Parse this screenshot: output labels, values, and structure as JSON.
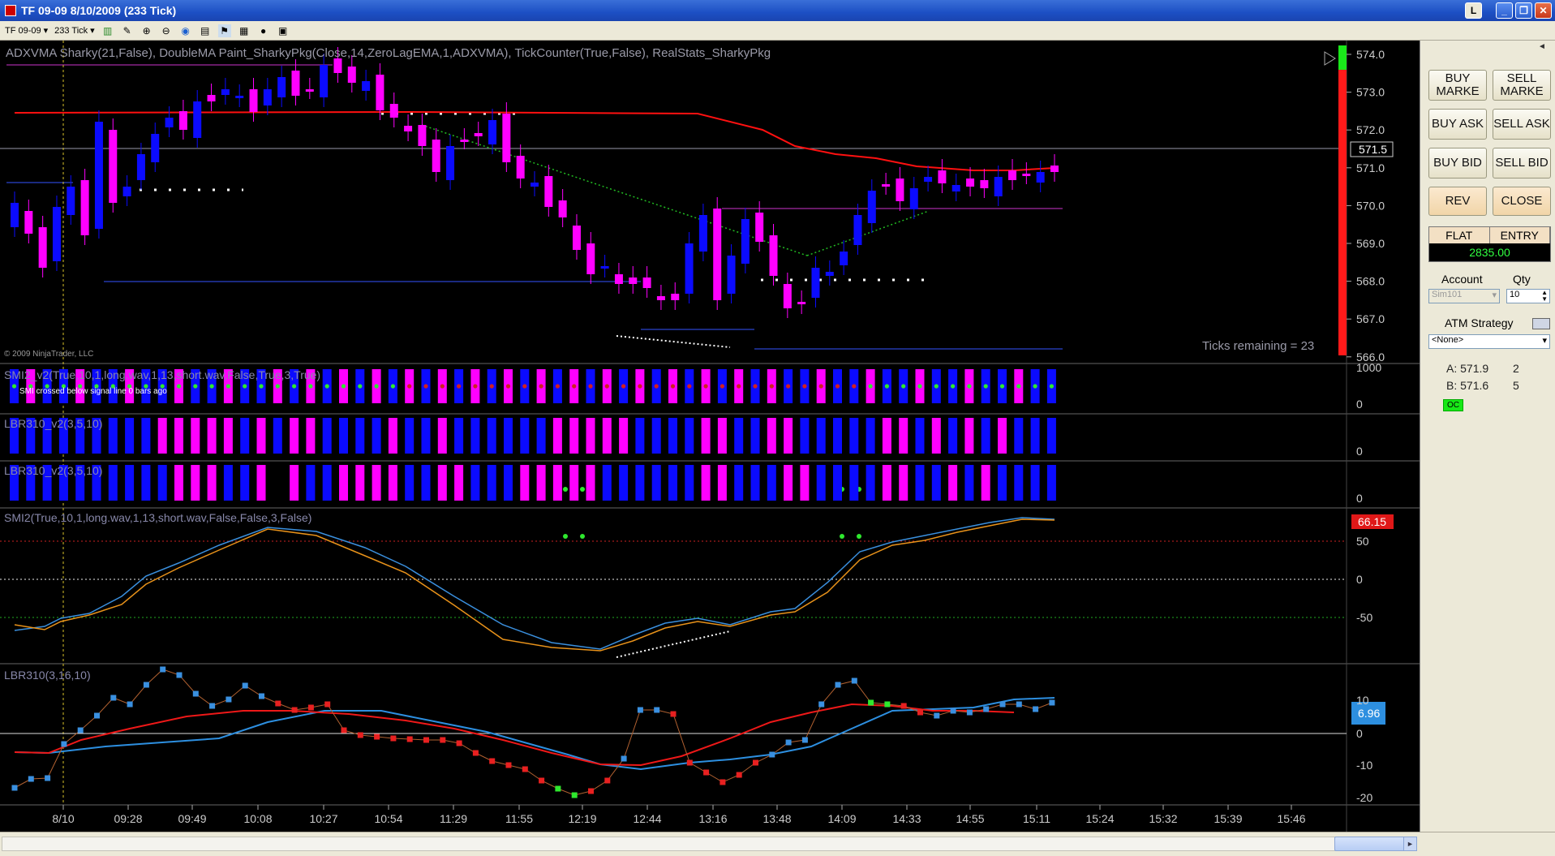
{
  "window": {
    "title": "TF 09-09  8/10/2009 (233 Tick)",
    "l_button": "L"
  },
  "toolbar": {
    "instrument": "TF 09-09",
    "period": "233 Tick"
  },
  "price_panel": {
    "indicators_label": "ADXVMA  Sharky(21,False),  DoubleMA  Paint_SharkyPkg(Close,14,ZeroLagEMA,1,ADXVMA),  TickCounter(True,False),  RealStats_SharkyPkg",
    "copyright": "© 2009 NinjaTrader, LLC",
    "ticks_remaining": "Ticks remaining = 23",
    "last_price": "571.5",
    "y_ticks": [
      "574.0",
      "573.0",
      "572.0",
      "571.0",
      "570.0",
      "569.0",
      "568.0",
      "567.0",
      "566.0"
    ]
  },
  "smi_v2_panel": {
    "label": "SMI2_v2(True,10,1,long.wav,1,13,short.wav,False,True,3,True)",
    "message": "SMI crossed below signal line  0 bars ago",
    "y_ticks": [
      "1000",
      "0"
    ]
  },
  "lbr_panel_a": {
    "label": "LBR310_v2(3,5,10)",
    "y_ticks": [
      "0"
    ]
  },
  "lbr_panel_b": {
    "label": "LBR310_v2(3,5,10)",
    "y_ticks": [
      "0"
    ]
  },
  "smi_panel": {
    "label": "SMI2(True,10,1,long.wav,1,13,short.wav,False,False,3,False)",
    "current_value": "66.15",
    "y_ticks": [
      "50",
      "0",
      "-50"
    ]
  },
  "lbr_panel": {
    "label": "LBR310(3,16,10)",
    "current_value": "6.96",
    "y_ticks": [
      "10",
      "0",
      "-10",
      "-20"
    ]
  },
  "time_axis": [
    "8/10",
    "09:28",
    "09:49",
    "10:08",
    "10:27",
    "10:54",
    "11:29",
    "11:55",
    "12:19",
    "12:44",
    "13:16",
    "13:48",
    "14:09",
    "14:33",
    "14:55",
    "15:11",
    "15:24",
    "15:32",
    "15:39",
    "15:46"
  ],
  "order_panel": {
    "buy_market": "BUY MARKE",
    "sell_market": "SELL MARKE",
    "buy_ask": "BUY ASK",
    "sell_ask": "SELL ASK",
    "buy_bid": "BUY BID",
    "sell_bid": "SELL BID",
    "rev": "REV",
    "close": "CLOSE",
    "position_label": "FLAT",
    "entry_label": "ENTRY",
    "entry_value": "2835.00",
    "account_label": "Account",
    "qty_label": "Qty",
    "account_value": "Sim101",
    "qty_value": "10",
    "atm_label": "ATM Strategy",
    "atm_value": "<None>",
    "ask_text": "A: 571.9",
    "ask_size": "2",
    "bid_text": "B: 571.6",
    "bid_size": "5",
    "oc_label": "OC"
  },
  "colors": {
    "up_bar": "#0b0bff",
    "down_bar": "#ff00ff",
    "ma_red": "#ff1010",
    "smi_blue": "#3a8fdd",
    "smi_orange": "#e8921a",
    "green_dot": "#2ee82e"
  }
}
